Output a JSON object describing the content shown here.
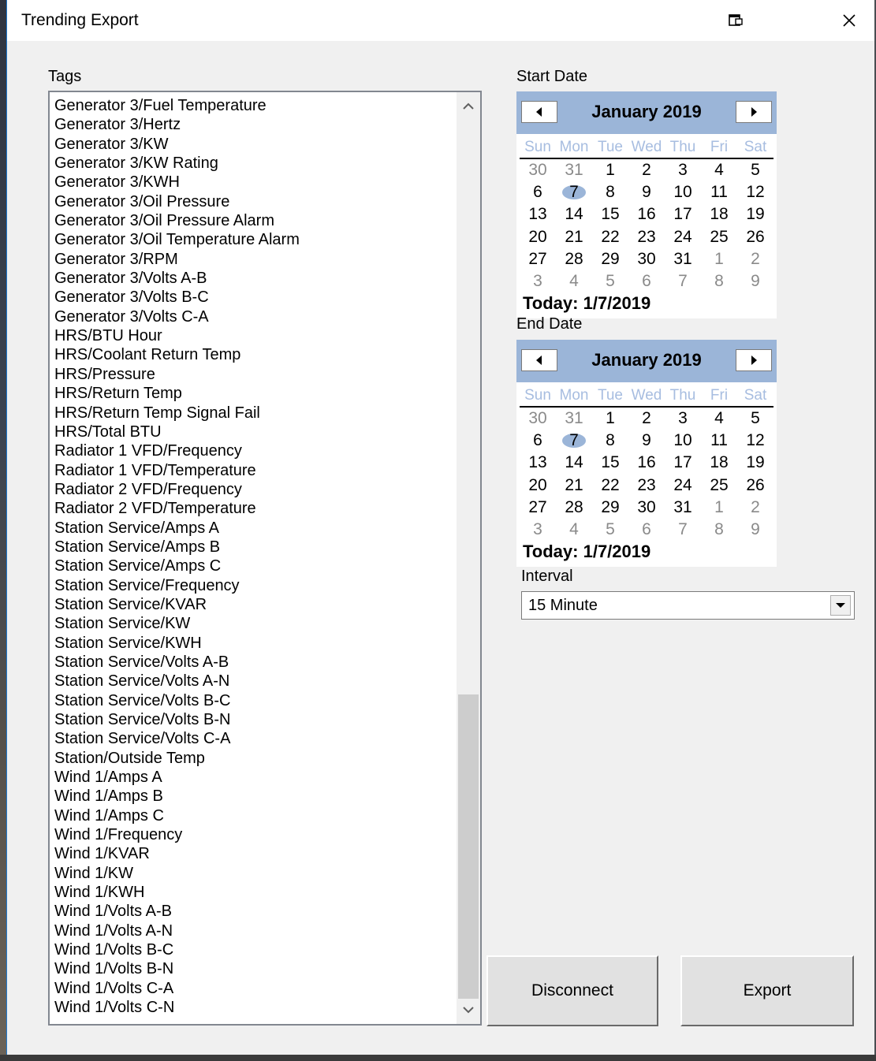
{
  "window": {
    "title": "Trending Export",
    "restore_icon": "restore-icon",
    "close_icon": "close-icon"
  },
  "tags": {
    "label": "Tags",
    "items": [
      "Generator 3/Fuel Temperature",
      "Generator 3/Hertz",
      "Generator 3/KW",
      "Generator 3/KW Rating",
      "Generator 3/KWH",
      "Generator 3/Oil Pressure",
      "Generator 3/Oil Pressure Alarm",
      "Generator 3/Oil Temperature Alarm",
      "Generator 3/RPM",
      "Generator 3/Volts A-B",
      "Generator 3/Volts B-C",
      "Generator 3/Volts C-A",
      "HRS/BTU Hour",
      "HRS/Coolant Return Temp",
      "HRS/Pressure",
      "HRS/Return Temp",
      "HRS/Return Temp Signal Fail",
      "HRS/Total BTU",
      "Radiator 1 VFD/Frequency",
      "Radiator 1 VFD/Temperature",
      "Radiator 2 VFD/Frequency",
      "Radiator 2 VFD/Temperature",
      "Station Service/Amps A",
      "Station Service/Amps B",
      "Station Service/Amps C",
      "Station Service/Frequency",
      "Station Service/KVAR",
      "Station Service/KW",
      "Station Service/KWH",
      "Station Service/Volts A-B",
      "Station Service/Volts A-N",
      "Station Service/Volts B-C",
      "Station Service/Volts B-N",
      "Station Service/Volts C-A",
      "Station/Outside Temp",
      "Wind 1/Amps A",
      "Wind 1/Amps B",
      "Wind 1/Amps C",
      "Wind 1/Frequency",
      "Wind 1/KVAR",
      "Wind 1/KW",
      "Wind 1/KWH",
      "Wind 1/Volts A-B",
      "Wind 1/Volts A-N",
      "Wind 1/Volts B-C",
      "Wind 1/Volts B-N",
      "Wind 1/Volts C-A",
      "Wind 1/Volts C-N"
    ]
  },
  "start_date": {
    "label": "Start Date",
    "month": "January 2019",
    "today": "Today: 1/7/2019",
    "selected": 7
  },
  "end_date": {
    "label": "End Date",
    "month": "January 2019",
    "today": "Today: 1/7/2019",
    "selected": 7
  },
  "calendar": {
    "days_of_week": [
      "Sun",
      "Mon",
      "Tue",
      "Wed",
      "Thu",
      "Fri",
      "Sat"
    ],
    "weeks": [
      [
        30,
        31,
        1,
        2,
        3,
        4,
        5
      ],
      [
        6,
        7,
        8,
        9,
        10,
        11,
        12
      ],
      [
        13,
        14,
        15,
        16,
        17,
        18,
        19
      ],
      [
        20,
        21,
        22,
        23,
        24,
        25,
        26
      ],
      [
        27,
        28,
        29,
        30,
        31,
        1,
        2
      ],
      [
        3,
        4,
        5,
        6,
        7,
        8,
        9
      ]
    ]
  },
  "interval": {
    "label": "Interval",
    "value": "15 Minute"
  },
  "buttons": {
    "disconnect": "Disconnect",
    "export": "Export"
  },
  "colors": {
    "calendar_header": "#9bb5d8",
    "day_of_week": "#a7bde0"
  }
}
